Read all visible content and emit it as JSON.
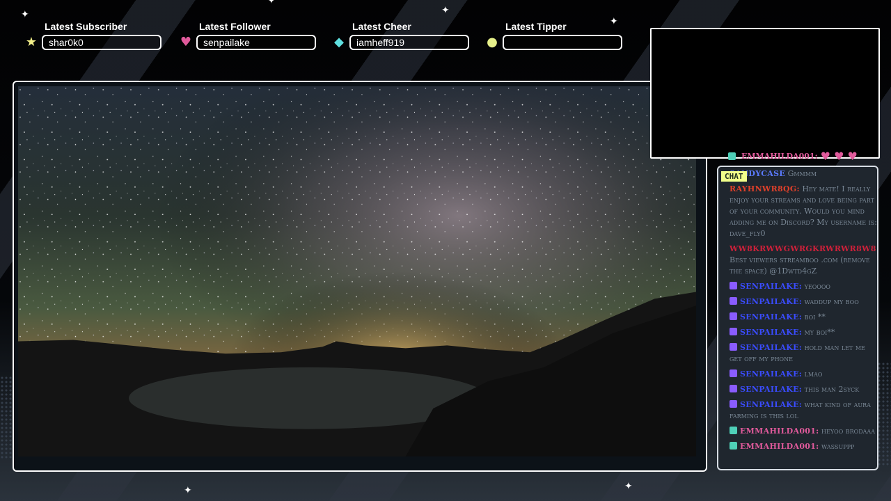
{
  "widgets": [
    {
      "label": "Latest Subscriber",
      "value": "shar0k0",
      "icon": "star-icon",
      "icon_glyph": "★",
      "icon_color": "#f3f08a"
    },
    {
      "label": "Latest Follower",
      "value": "senpailake",
      "icon": "heart-icon",
      "icon_glyph": "♥",
      "icon_color": "#e05a9b"
    },
    {
      "label": "Latest Cheer",
      "value": "iamheff919",
      "icon": "gem-icon",
      "icon_glyph": "◆",
      "icon_color": "#5fe0e0"
    },
    {
      "label": "Latest Tipper",
      "value": "",
      "icon": "coin-icon",
      "icon_glyph": "●",
      "icon_color": "#e6f08a"
    }
  ],
  "chat": {
    "tag": "CHAT",
    "top_message": {
      "user": "EMMAHILDA001:",
      "user_color": "#e05a9b",
      "hearts": "♥ ♥ ♥"
    },
    "messages": [
      {
        "user": "SANDYCASE",
        "text": "Gmmmm",
        "color": "#5b7aff"
      },
      {
        "user": "RAYHNWR8QG:",
        "text": "Hey mate! I really enjoy your streams and love being part of your community. Would you mind adding me on Discord? My username is: dave_fly0",
        "color": "#e0402a"
      },
      {
        "user": "WW8KRWWGWRGKRWRWR8W8",
        "text": "Best viewers streamboo .com (remove the space) @1Dwtd4gZ",
        "color": "#d0203a"
      },
      {
        "user": "SENPAILAKE:",
        "text": "yeoooo",
        "color": "#3a4cff",
        "badge": "#8a5cff"
      },
      {
        "user": "SENPAILAKE:",
        "text": "waddup my boo",
        "color": "#3a4cff",
        "badge": "#8a5cff"
      },
      {
        "user": "SENPAILAKE:",
        "text": "boi **",
        "color": "#3a4cff",
        "badge": "#8a5cff"
      },
      {
        "user": "SENPAILAKE:",
        "text": "my boi**",
        "color": "#3a4cff",
        "badge": "#8a5cff"
      },
      {
        "user": "SENPAILAKE:",
        "text": "hold man let me get off my phone",
        "color": "#3a4cff",
        "badge": "#8a5cff"
      },
      {
        "user": "SENPAILAKE:",
        "text": "lmao",
        "color": "#3a4cff",
        "badge": "#8a5cff"
      },
      {
        "user": "SENPAILAKE:",
        "text": "this man 2syck",
        "color": "#3a4cff",
        "badge": "#8a5cff"
      },
      {
        "user": "SENPAILAKE:",
        "text": "what kind of aura farming is this lol",
        "color": "#3a4cff",
        "badge": "#8a5cff"
      },
      {
        "user": "EMMAHILDA001:",
        "text": "heyoo brodaaa",
        "color": "#e05a9b",
        "badge": "#4fd0b8"
      },
      {
        "user": "EMMAHILDA001:",
        "text": "wassuppp",
        "color": "#e05a9b",
        "badge": "#4fd0b8"
      }
    ]
  }
}
